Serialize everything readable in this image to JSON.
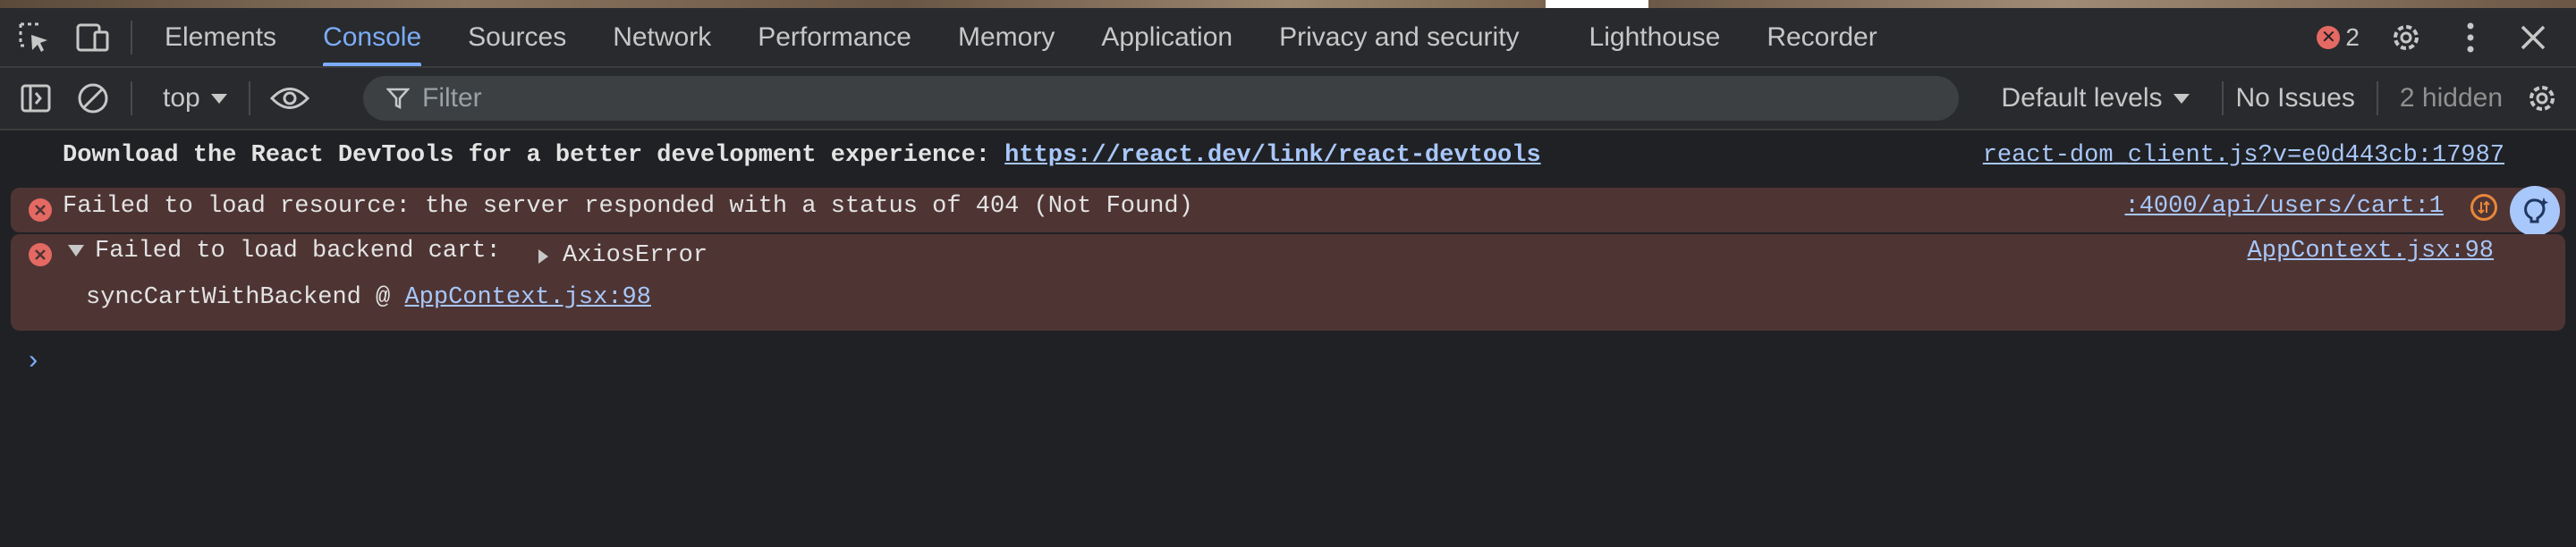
{
  "tabs": [
    {
      "label": "Elements",
      "active": false
    },
    {
      "label": "Console",
      "active": true
    },
    {
      "label": "Sources",
      "active": false
    },
    {
      "label": "Network",
      "active": false
    },
    {
      "label": "Performance",
      "active": false
    },
    {
      "label": "Memory",
      "active": false
    },
    {
      "label": "Application",
      "active": false
    },
    {
      "label": "Privacy and security",
      "active": false
    },
    {
      "label": "Lighthouse",
      "active": false
    },
    {
      "label": "Recorder",
      "active": false
    }
  ],
  "error_count": "2",
  "toolbar": {
    "context": "top",
    "filter_placeholder": "Filter",
    "levels": "Default levels",
    "issues": "No Issues",
    "hidden": "2 hidden"
  },
  "messages": {
    "info": {
      "text": "Download the React DevTools for a better development experience: ",
      "link": "https://react.dev/link/react-devtools",
      "source": "react-dom_client.js?v=e0d443cb:17987"
    },
    "error1": {
      "text": "Failed to load resource: the server responded with a status of 404 (Not Found)",
      "source": ":4000/api/users/cart:1"
    },
    "error2": {
      "text": "Failed to load backend cart:",
      "object": "AxiosError",
      "source": "AppContext.jsx:98",
      "stack_fn": "syncCartWithBackend @ ",
      "stack_link": "AppContext.jsx:98"
    }
  },
  "prompt_symbol": "›",
  "colors": {
    "background": "#202124",
    "accent": "#7cacf8",
    "error_bg": "#4e3534",
    "error_icon": "#e46962",
    "link": "#a8c7fa"
  }
}
